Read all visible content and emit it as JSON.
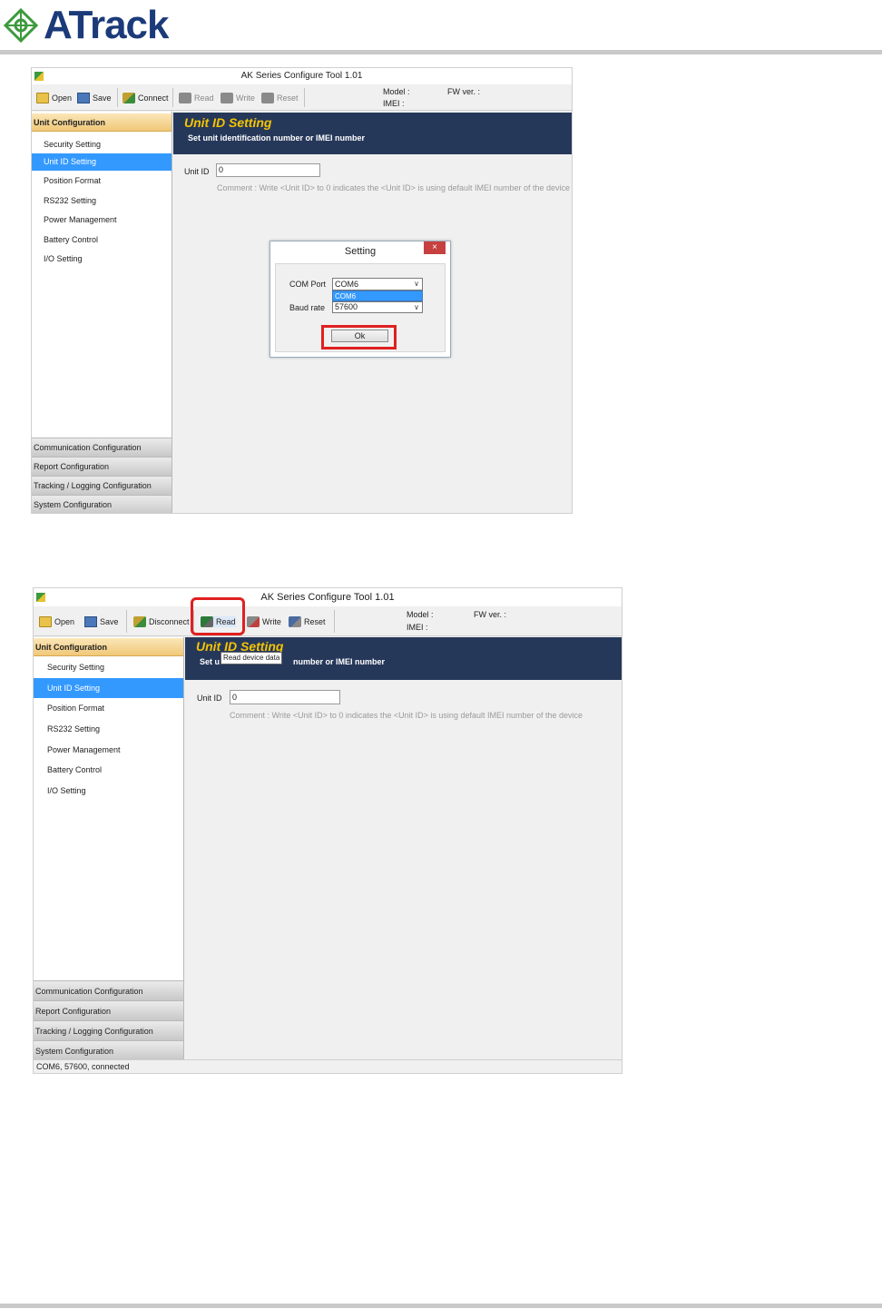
{
  "brand": {
    "name": "ATrack"
  },
  "window1": {
    "title": "AK Series Configure Tool 1.01",
    "toolbar": {
      "open": "Open",
      "save": "Save",
      "connect": "Connect",
      "read": "Read",
      "write": "Write",
      "reset": "Reset"
    },
    "info": {
      "model_label": "Model :",
      "fw_label": "FW ver. :",
      "imei_label": "IMEI :"
    },
    "sidebar": {
      "header": "Unit Configuration",
      "items": [
        "Security Setting",
        "Unit ID Setting",
        "Position Format",
        "RS232 Setting",
        "Power Management",
        "Battery Control",
        "I/O Setting"
      ],
      "selected": "Unit ID Setting",
      "categories": [
        "Communication Configuration",
        "Report Configuration",
        "Tracking / Logging Configuration",
        "System Configuration"
      ]
    },
    "banner": {
      "title": "Unit ID Setting",
      "subtitle": "Set unit identification number or IMEI number"
    },
    "form": {
      "unit_id_label": "Unit ID",
      "unit_id_value": "0",
      "comment": "Comment : Write <Unit ID> to 0 indicates the <Unit ID> is using default IMEI number of the device"
    },
    "dialog": {
      "title": "Setting",
      "close": "×",
      "com_port_label": "COM Port",
      "com_port_value": "COM6",
      "dropdown_option": "COM6",
      "baud_rate_label": "Baud rate",
      "baud_rate_value": "57600",
      "ok": "Ok"
    }
  },
  "window2": {
    "title": "AK Series Configure Tool 1.01",
    "toolbar": {
      "open": "Open",
      "save": "Save",
      "disconnect": "Disconnect",
      "read": "Read",
      "write": "Write",
      "reset": "Reset"
    },
    "tooltip": "Read device data",
    "info": {
      "model_label": "Model :",
      "fw_label": "FW ver. :",
      "imei_label": "IMEI :"
    },
    "sidebar": {
      "header": "Unit Configuration",
      "items": [
        "Security Setting",
        "Unit ID Setting",
        "Position Format",
        "RS232 Setting",
        "Power Management",
        "Battery Control",
        "I/O Setting"
      ],
      "selected": "Unit ID Setting",
      "categories": [
        "Communication Configuration",
        "Report Configuration",
        "Tracking / Logging Configuration",
        "System Configuration"
      ]
    },
    "banner": {
      "title": "Unit ID Setting",
      "subtitle_start": "Set u",
      "subtitle_end": "number or IMEI number"
    },
    "form": {
      "unit_id_label": "Unit ID",
      "unit_id_value": "0",
      "comment": "Comment : Write <Unit ID> to 0 indicates the <Unit ID> is using default IMEI number of the device"
    },
    "status": "COM6, 57600, connected"
  }
}
